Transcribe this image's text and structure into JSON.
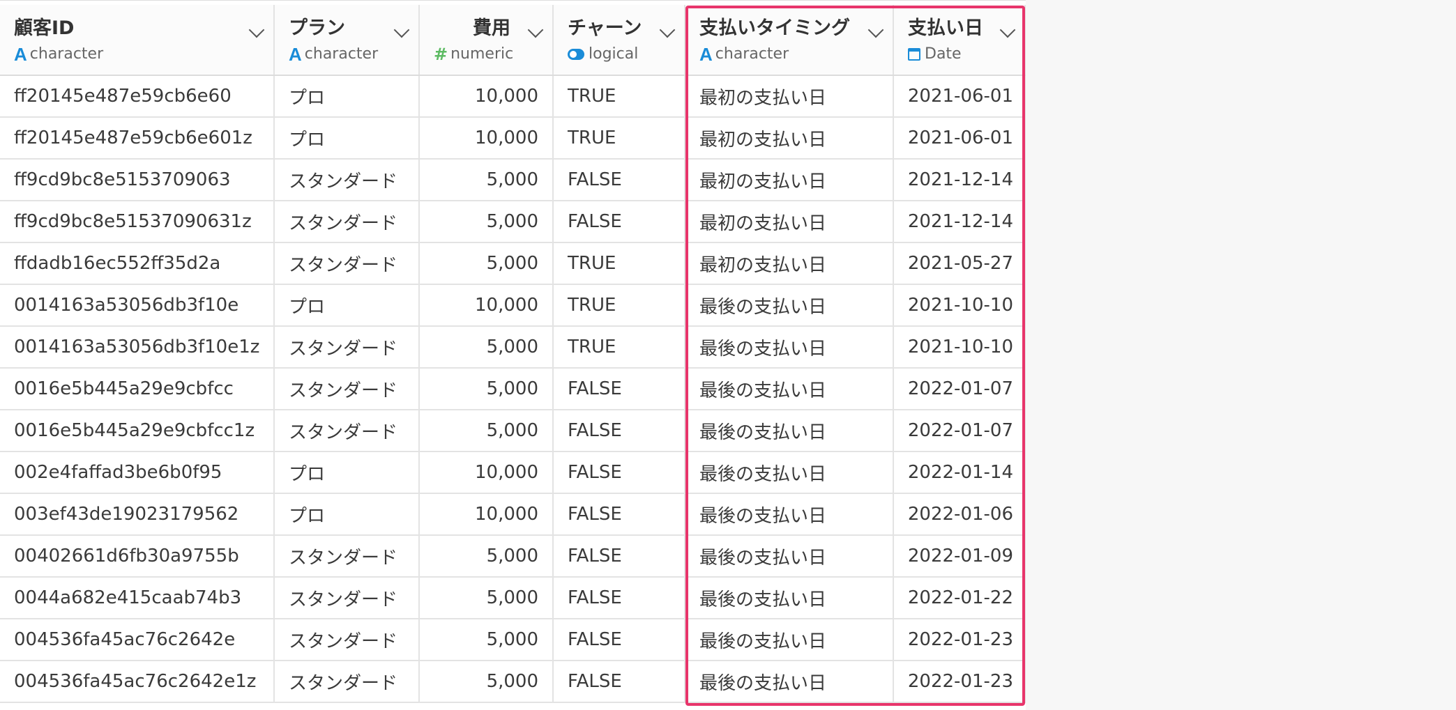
{
  "columns": [
    {
      "name": "顧客ID",
      "type": "character",
      "type_icon": "character-type-icon"
    },
    {
      "name": "プラン",
      "type": "character",
      "type_icon": "character-type-icon"
    },
    {
      "name": "費用",
      "type": "numeric",
      "type_icon": "numeric-type-icon"
    },
    {
      "name": "チャーン",
      "type": "logical",
      "type_icon": "logical-type-icon"
    },
    {
      "name": "支払いタイミング",
      "type": "character",
      "type_icon": "character-type-icon"
    },
    {
      "name": "支払い日",
      "type": "Date",
      "type_icon": "date-type-icon"
    }
  ],
  "rows": [
    [
      "ff20145e487e59cb6e60",
      "プロ",
      "10,000",
      "TRUE",
      "最初の支払い日",
      "2021-06-01"
    ],
    [
      "ff20145e487e59cb6e601z",
      "プロ",
      "10,000",
      "TRUE",
      "最初の支払い日",
      "2021-06-01"
    ],
    [
      "ff9cd9bc8e5153709063",
      "スタンダード",
      "5,000",
      "FALSE",
      "最初の支払い日",
      "2021-12-14"
    ],
    [
      "ff9cd9bc8e51537090631z",
      "スタンダード",
      "5,000",
      "FALSE",
      "最初の支払い日",
      "2021-12-14"
    ],
    [
      "ffdadb16ec552ff35d2a",
      "スタンダード",
      "5,000",
      "TRUE",
      "最初の支払い日",
      "2021-05-27"
    ],
    [
      "0014163a53056db3f10e",
      "プロ",
      "10,000",
      "TRUE",
      "最後の支払い日",
      "2021-10-10"
    ],
    [
      "0014163a53056db3f10e1z",
      "スタンダード",
      "5,000",
      "TRUE",
      "最後の支払い日",
      "2021-10-10"
    ],
    [
      "0016e5b445a29e9cbfcc",
      "スタンダード",
      "5,000",
      "FALSE",
      "最後の支払い日",
      "2022-01-07"
    ],
    [
      "0016e5b445a29e9cbfcc1z",
      "スタンダード",
      "5,000",
      "FALSE",
      "最後の支払い日",
      "2022-01-07"
    ],
    [
      "002e4faffad3be6b0f95",
      "プロ",
      "10,000",
      "FALSE",
      "最後の支払い日",
      "2022-01-14"
    ],
    [
      "003ef43de19023179562",
      "プロ",
      "10,000",
      "FALSE",
      "最後の支払い日",
      "2022-01-06"
    ],
    [
      "00402661d6fb30a9755b",
      "スタンダード",
      "5,000",
      "FALSE",
      "最後の支払い日",
      "2022-01-09"
    ],
    [
      "0044a682e415caab74b3",
      "スタンダード",
      "5,000",
      "FALSE",
      "最後の支払い日",
      "2022-01-22"
    ],
    [
      "004536fa45ac76c2642e",
      "スタンダード",
      "5,000",
      "FALSE",
      "最後の支払い日",
      "2022-01-23"
    ],
    [
      "004536fa45ac76c2642e1z",
      "スタンダード",
      "5,000",
      "FALSE",
      "最後の支払い日",
      "2022-01-23"
    ]
  ],
  "highlight": {
    "columns": [
      "支払いタイミング",
      "支払い日"
    ],
    "color": "#e8356b"
  },
  "colors": {
    "character": "#1a8cd8",
    "numeric": "#5dbb63",
    "logical": "#1a8cd8",
    "date": "#1a8cd8"
  }
}
